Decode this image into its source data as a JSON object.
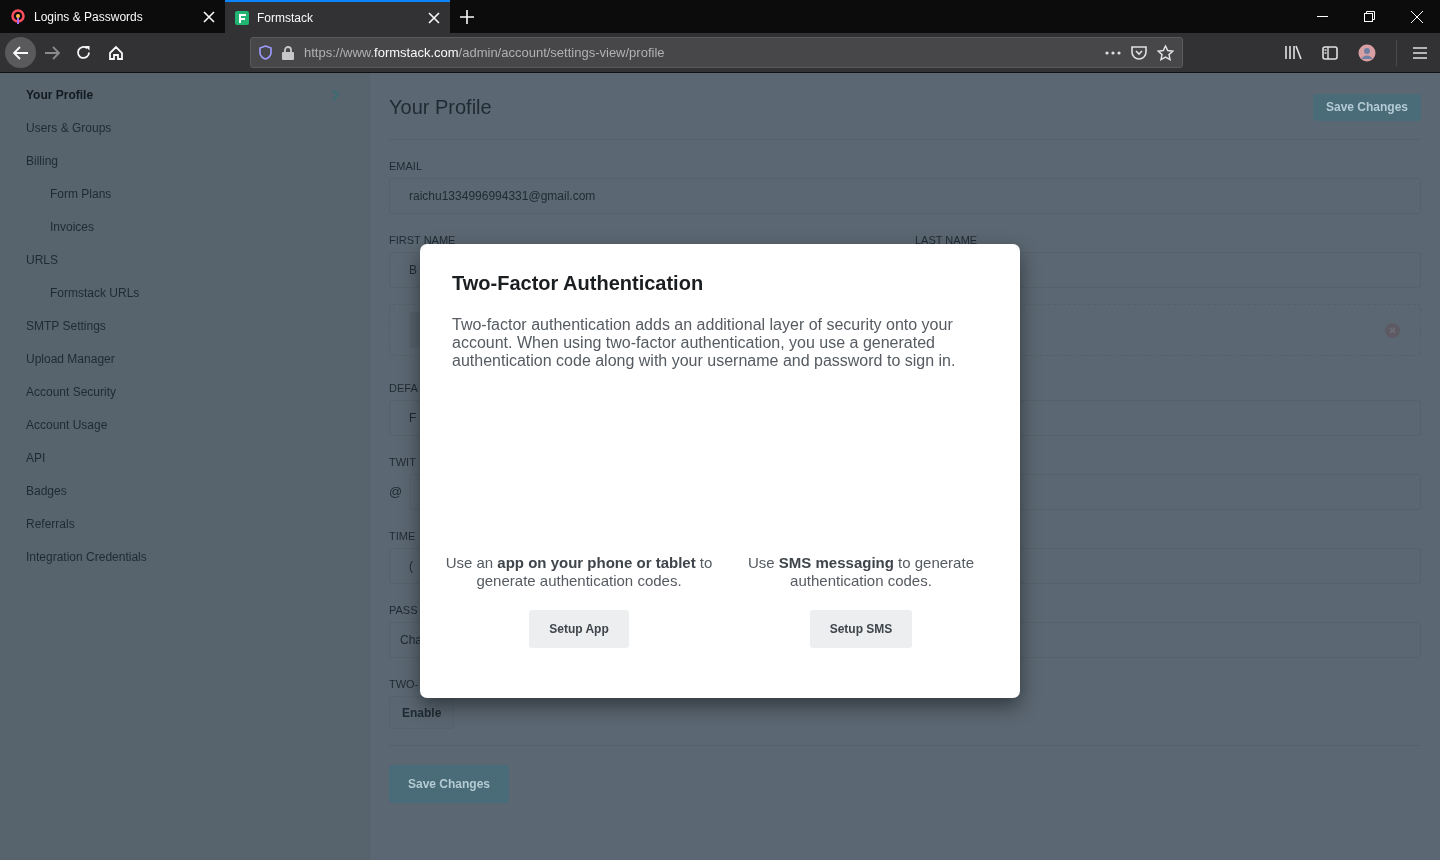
{
  "browser": {
    "tabs": [
      {
        "title": "Logins & Passwords",
        "selected": false,
        "kind": "logins"
      },
      {
        "title": "Formstack",
        "selected": true,
        "kind": "formstack"
      }
    ],
    "url": {
      "prefix": "https://www.",
      "domain": "formstack.com",
      "path": "/admin/account/settings-view/profile"
    }
  },
  "sidebar": {
    "items": [
      {
        "label": "Your Profile",
        "selected": true
      },
      {
        "label": "Users & Groups",
        "selected": false
      },
      {
        "label": "Billing",
        "selected": false,
        "children": [
          {
            "label": "Form Plans",
            "selected": false
          },
          {
            "label": "Invoices",
            "selected": false
          }
        ]
      },
      {
        "label": "URLS",
        "selected": false,
        "children": [
          {
            "label": "Formstack URLs",
            "selected": false
          }
        ]
      },
      {
        "label": "SMTP Settings",
        "selected": false
      },
      {
        "label": "Upload Manager",
        "selected": false
      },
      {
        "label": "Account Security",
        "selected": false
      },
      {
        "label": "Account Usage",
        "selected": false
      },
      {
        "label": "API",
        "selected": false
      },
      {
        "label": "Badges",
        "selected": false
      },
      {
        "label": "Referrals",
        "selected": false
      },
      {
        "label": "Integration Credentials",
        "selected": false
      }
    ]
  },
  "main": {
    "title": "Your Profile",
    "save_button": "Save Changes",
    "fields": [
      {
        "kind": "text",
        "label": "EMAIL",
        "value": "raichu1334996994331@gmail.com"
      },
      {
        "kind": "pair",
        "label": "FIRST NAME",
        "value": "B",
        "label_2": "LAST NAME"
      },
      {
        "kind": "upload"
      },
      {
        "kind": "text",
        "label": "DEFA",
        "value": "F"
      },
      {
        "kind": "twitter",
        "label": "TWIT",
        "prefix": "@"
      },
      {
        "kind": "text",
        "label": "TIME",
        "value": "("
      },
      {
        "kind": "password",
        "label": "PASS",
        "value": "Cha"
      },
      {
        "kind": "button",
        "label": "TWO-",
        "value": "Enable"
      }
    ],
    "bottom_button": "Save Changes"
  },
  "modal": {
    "title": "Two-Factor Authentication",
    "body": "Two-factor authentication adds an additional layer of security onto your account. When using two-factor authentication, you use a generated authentication code along with your username and password to sign in.",
    "options": [
      {
        "text": "Use an **app on your phone or tablet** to generate authentication codes.",
        "button": "Setup App"
      },
      {
        "text": "Use **SMS messaging** to generate authentication codes.",
        "button": "Setup SMS"
      }
    ]
  }
}
